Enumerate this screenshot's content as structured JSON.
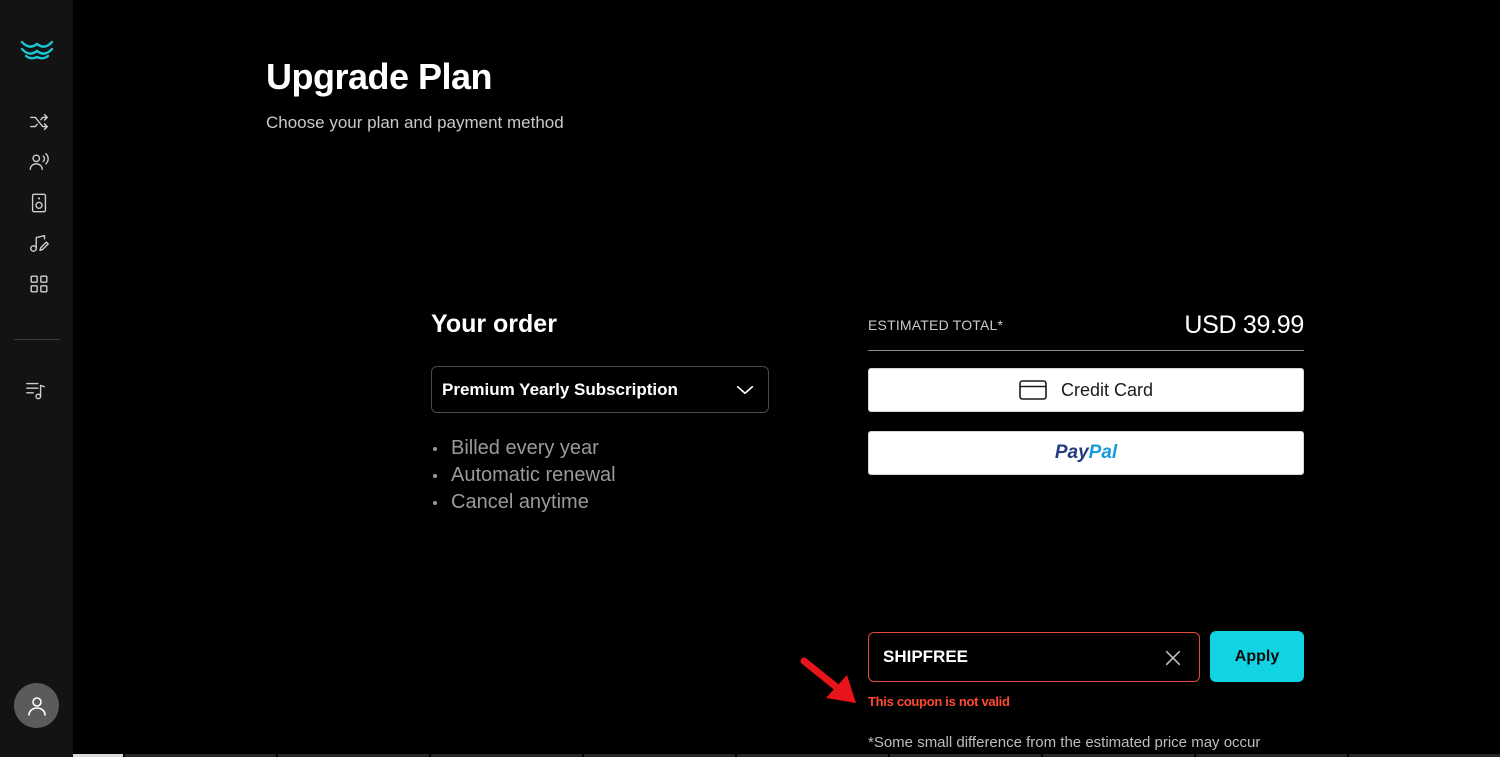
{
  "sidebar": {
    "logo": "waves-logo",
    "items": [
      {
        "icon": "shuffle-icon"
      },
      {
        "icon": "voice-user-icon"
      },
      {
        "icon": "speaker-icon"
      },
      {
        "icon": "music-edit-icon"
      },
      {
        "icon": "grid-apps-icon"
      },
      {
        "icon": "playlist-music-icon"
      }
    ],
    "avatar_icon": "user-icon"
  },
  "header": {
    "title": "Upgrade Plan",
    "subtitle": "Choose your plan and payment method"
  },
  "order": {
    "title": "Your order",
    "plan_selected": "Premium Yearly Subscription",
    "features": [
      "Billed every year",
      "Automatic renewal",
      "Cancel anytime"
    ]
  },
  "payment": {
    "estimated_label": "ESTIMATED TOTAL*",
    "estimated_value": "USD 39.99",
    "credit_card_label": "Credit Card",
    "paypal_part1": "Pay",
    "paypal_part2": "Pal"
  },
  "coupon": {
    "value": "SHIPFREE",
    "apply_label": "Apply",
    "error": "This coupon is not valid"
  },
  "footnote": "*Some small difference from the estimated price may occur",
  "colors": {
    "accent": "#12d3e3",
    "error": "#ff4a2f",
    "sidebar_bg": "#131313",
    "annotation_arrow": "#e8141b"
  }
}
